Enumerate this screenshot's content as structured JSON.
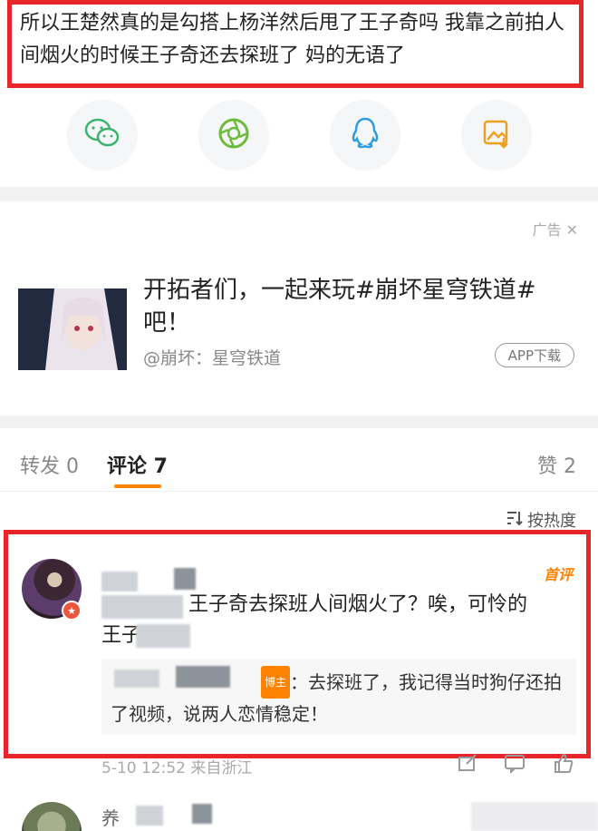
{
  "post": {
    "text": "所以王楚然真的是勾搭上杨洋然后甩了王子奇吗 我靠之前拍人间烟火的时候王子奇还去探班了 妈的无语了"
  },
  "share": {
    "icons": [
      "wechat-icon",
      "moments-icon",
      "qq-icon",
      "save-image-icon"
    ]
  },
  "ad": {
    "tag": "广告",
    "title": "开拓者们，一起来玩#崩坏星穹铁道#吧！",
    "source": "@崩坏：星穹铁道",
    "button": "APP下载"
  },
  "tabs": {
    "repost": "转发 0",
    "comments": "评论 7",
    "likes": "赞 2"
  },
  "sort": {
    "label": "按热度"
  },
  "comment": {
    "tag": "首评",
    "text_visible_1": "王子奇去探班人间烟火了？唉，可怜的",
    "text_visible_2": "王子",
    "reply_badge": "博主",
    "reply_text": "：去探班了，我记得当时狗仔还拍了视频，说两人恋情稳定！",
    "meta": "5-10 12:52 来自浙江"
  },
  "comment2": {
    "name_visible": "养"
  },
  "colors": {
    "highlight_border": "#e8262a",
    "accent": "#ff8200"
  }
}
